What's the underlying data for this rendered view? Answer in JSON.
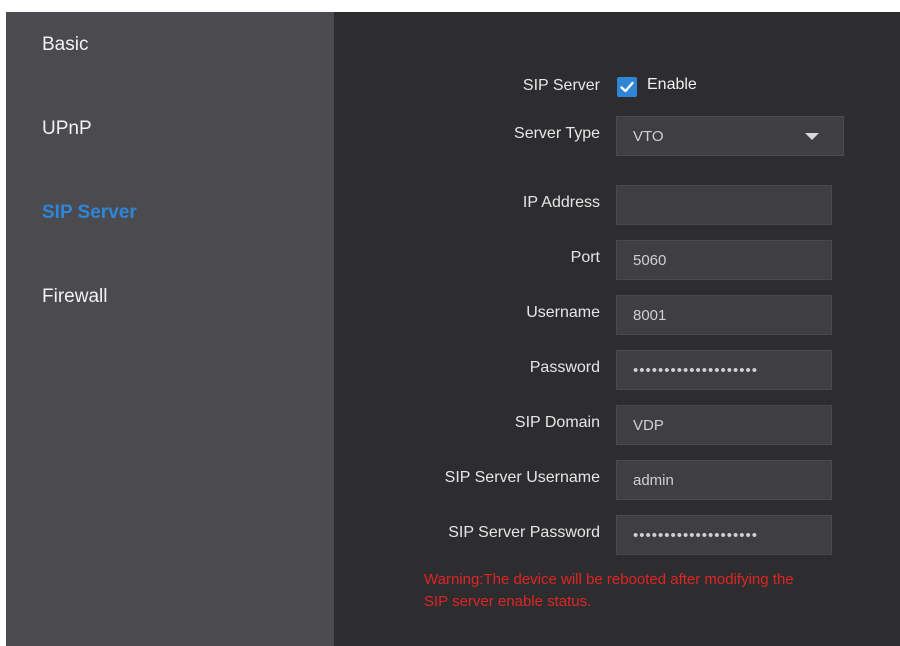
{
  "sidebar": {
    "items": [
      {
        "label": "Basic"
      },
      {
        "label": "UPnP"
      },
      {
        "label": "SIP Server"
      },
      {
        "label": "Firewall"
      }
    ],
    "active_index": 2
  },
  "form": {
    "sip_server": {
      "label": "SIP Server",
      "checkbox_label": "Enable",
      "checked": true
    },
    "server_type": {
      "label": "Server Type",
      "value": "VTO"
    },
    "ip_address": {
      "label": "IP Address",
      "value": ""
    },
    "port": {
      "label": "Port",
      "value": "5060"
    },
    "username": {
      "label": "Username",
      "value": "8001"
    },
    "password": {
      "label": "Password",
      "value": "••••••••••••••••••••"
    },
    "sip_domain": {
      "label": "SIP Domain",
      "value": "VDP"
    },
    "sip_server_username": {
      "label": "SIP Server Username",
      "value": "admin"
    },
    "sip_server_password": {
      "label": "SIP Server Password",
      "value": "••••••••••••••••••••"
    }
  },
  "warning": {
    "line1": "Warning:The device will be rebooted after modifying the",
    "line2": "SIP server enable status."
  },
  "colors": {
    "accent": "#2f86d8",
    "warning": "#e02424",
    "sidebar_bg": "#4a4a4f",
    "content_bg": "#2d2d30"
  }
}
